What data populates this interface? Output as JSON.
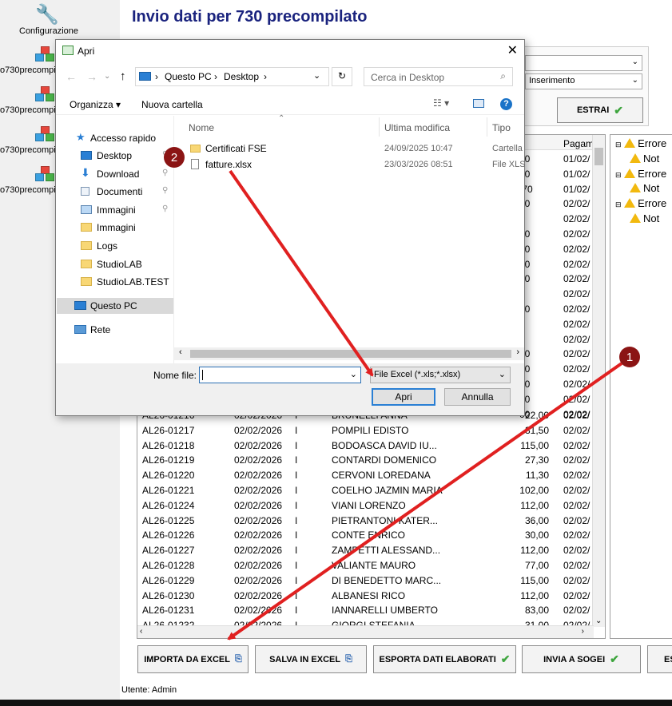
{
  "sidebar": {
    "config_label": "Configurazione",
    "items": [
      "o730precompi",
      "o730precompi",
      "o730precompi",
      "o730precompi"
    ]
  },
  "main": {
    "title": "Invio dati per 730 precompilato",
    "combo_top": "",
    "combo_mode": "Inserimento",
    "extract_label": "ESTRAI"
  },
  "grid": {
    "header_pagam": "Pagam",
    "partial_rows": [
      {
        "amt": "00",
        "date": "01/02/"
      },
      {
        "amt": "00",
        "date": "01/02/"
      },
      {
        "amt": ",70",
        "date": "01/02/"
      },
      {
        "amt": "00",
        "date": "02/02/"
      },
      {
        "amt": "5",
        "date": "02/02/"
      },
      {
        "amt": "00",
        "date": "02/02/"
      },
      {
        "amt": "00",
        "date": "02/02/"
      },
      {
        "amt": "00",
        "date": "02/02/"
      },
      {
        "amt": "00",
        "date": "02/02/"
      },
      {
        "amt": "",
        "date": "02/02/"
      },
      {
        "amt": "00",
        "date": "02/02/"
      },
      {
        "amt": "",
        "date": "02/02/"
      },
      {
        "amt": "",
        "date": "02/02/"
      },
      {
        "amt": "00",
        "date": "02/02/"
      },
      {
        "amt": "00",
        "date": "02/02/"
      },
      {
        "amt": "00",
        "date": "02/02/"
      },
      {
        "amt": "00",
        "date": "02/02/"
      },
      {
        "amt": "00",
        "date": "02/02/"
      }
    ],
    "rows": [
      {
        "code": "AL26-01216",
        "date": "02/02/2026",
        "type": "I",
        "name": "BRUNELLI ANNA",
        "amount": "22,00",
        "pay": "02/02/"
      },
      {
        "code": "AL26-01217",
        "date": "02/02/2026",
        "type": "I",
        "name": "POMPILI EDISTO",
        "amount": "31,50",
        "pay": "02/02/"
      },
      {
        "code": "AL26-01218",
        "date": "02/02/2026",
        "type": "I",
        "name": "BODOASCA DAVID IU...",
        "amount": "115,00",
        "pay": "02/02/"
      },
      {
        "code": "AL26-01219",
        "date": "02/02/2026",
        "type": "I",
        "name": "CONTARDI DOMENICO",
        "amount": "27,30",
        "pay": "02/02/"
      },
      {
        "code": "AL26-01220",
        "date": "02/02/2026",
        "type": "I",
        "name": "CERVONI LOREDANA",
        "amount": "11,30",
        "pay": "02/02/"
      },
      {
        "code": "AL26-01221",
        "date": "02/02/2026",
        "type": "I",
        "name": "COELHO JAZMIN MARIA",
        "amount": "102,00",
        "pay": "02/02/"
      },
      {
        "code": "AL26-01224",
        "date": "02/02/2026",
        "type": "I",
        "name": "VIANI LORENZO",
        "amount": "112,00",
        "pay": "02/02/"
      },
      {
        "code": "AL26-01225",
        "date": "02/02/2026",
        "type": "I",
        "name": "PIETRANTONI KATER...",
        "amount": "36,00",
        "pay": "02/02/"
      },
      {
        "code": "AL26-01226",
        "date": "02/02/2026",
        "type": "I",
        "name": "CONTE ENRICO",
        "amount": "30,00",
        "pay": "02/02/"
      },
      {
        "code": "AL26-01227",
        "date": "02/02/2026",
        "type": "I",
        "name": "ZAMPETTI ALESSAND...",
        "amount": "112,00",
        "pay": "02/02/"
      },
      {
        "code": "AL26-01228",
        "date": "02/02/2026",
        "type": "I",
        "name": "VALIANTE MAURO",
        "amount": "77,00",
        "pay": "02/02/"
      },
      {
        "code": "AL26-01229",
        "date": "02/02/2026",
        "type": "I",
        "name": "DI BENEDETTO MARC...",
        "amount": "115,00",
        "pay": "02/02/"
      },
      {
        "code": "AL26-01230",
        "date": "02/02/2026",
        "type": "I",
        "name": "ALBANESI RICO",
        "amount": "112,00",
        "pay": "02/02/"
      },
      {
        "code": "AL26-01231",
        "date": "02/02/2026",
        "type": "I",
        "name": "IANNARELLI UMBERTO",
        "amount": "83,00",
        "pay": "02/02/"
      },
      {
        "code": "AL26-01232",
        "date": "02/02/2026",
        "type": "I",
        "name": "GIORGI STEFANIA",
        "amount": "31,00",
        "pay": "02/02/"
      }
    ]
  },
  "tree": {
    "items": [
      {
        "label": "Errore",
        "level": 0
      },
      {
        "label": "Not",
        "level": 1
      },
      {
        "label": "Errore",
        "level": 0
      },
      {
        "label": "Not",
        "level": 1
      },
      {
        "label": "Errore",
        "level": 0
      },
      {
        "label": "Not",
        "level": 1
      }
    ]
  },
  "bottom_buttons": {
    "import": "IMPORTA DA EXCEL",
    "save": "SALVA IN EXCEL",
    "export": "ESPORTA DATI ELABORATI",
    "send": "INVIA A SOGEI",
    "more": "ES"
  },
  "status": {
    "user": "Utente:  Admin"
  },
  "dialog": {
    "title": "Apri",
    "path": [
      "Questo PC",
      "Desktop"
    ],
    "search_placeholder": "Cerca in Desktop",
    "organize": "Organizza",
    "new_folder": "Nuova cartella",
    "nav": {
      "quick_access": "Accesso rapido",
      "items": [
        "Desktop",
        "Download",
        "Documenti",
        "Immagini",
        "Immagini",
        "Logs",
        "StudioLAB",
        "StudioLAB.TEST"
      ],
      "this_pc": "Questo PC",
      "network": "Rete"
    },
    "columns": {
      "name": "Nome",
      "modified": "Ultima modifica",
      "type": "Tipo"
    },
    "files": [
      {
        "name": "Certificati FSE",
        "modified": "24/09/2025 10:47",
        "type": "Cartella"
      },
      {
        "name": "fatture.xlsx",
        "modified": "23/03/2026 08:51",
        "type": "File XLS"
      }
    ],
    "filename_label": "Nome file:",
    "filename_value": "",
    "filter": "File Excel (*.xls;*.xlsx)",
    "open": "Apri",
    "cancel": "Annulla"
  },
  "annotations": {
    "step1": "1",
    "step2": "2",
    "arrow_color": "#e02020"
  }
}
